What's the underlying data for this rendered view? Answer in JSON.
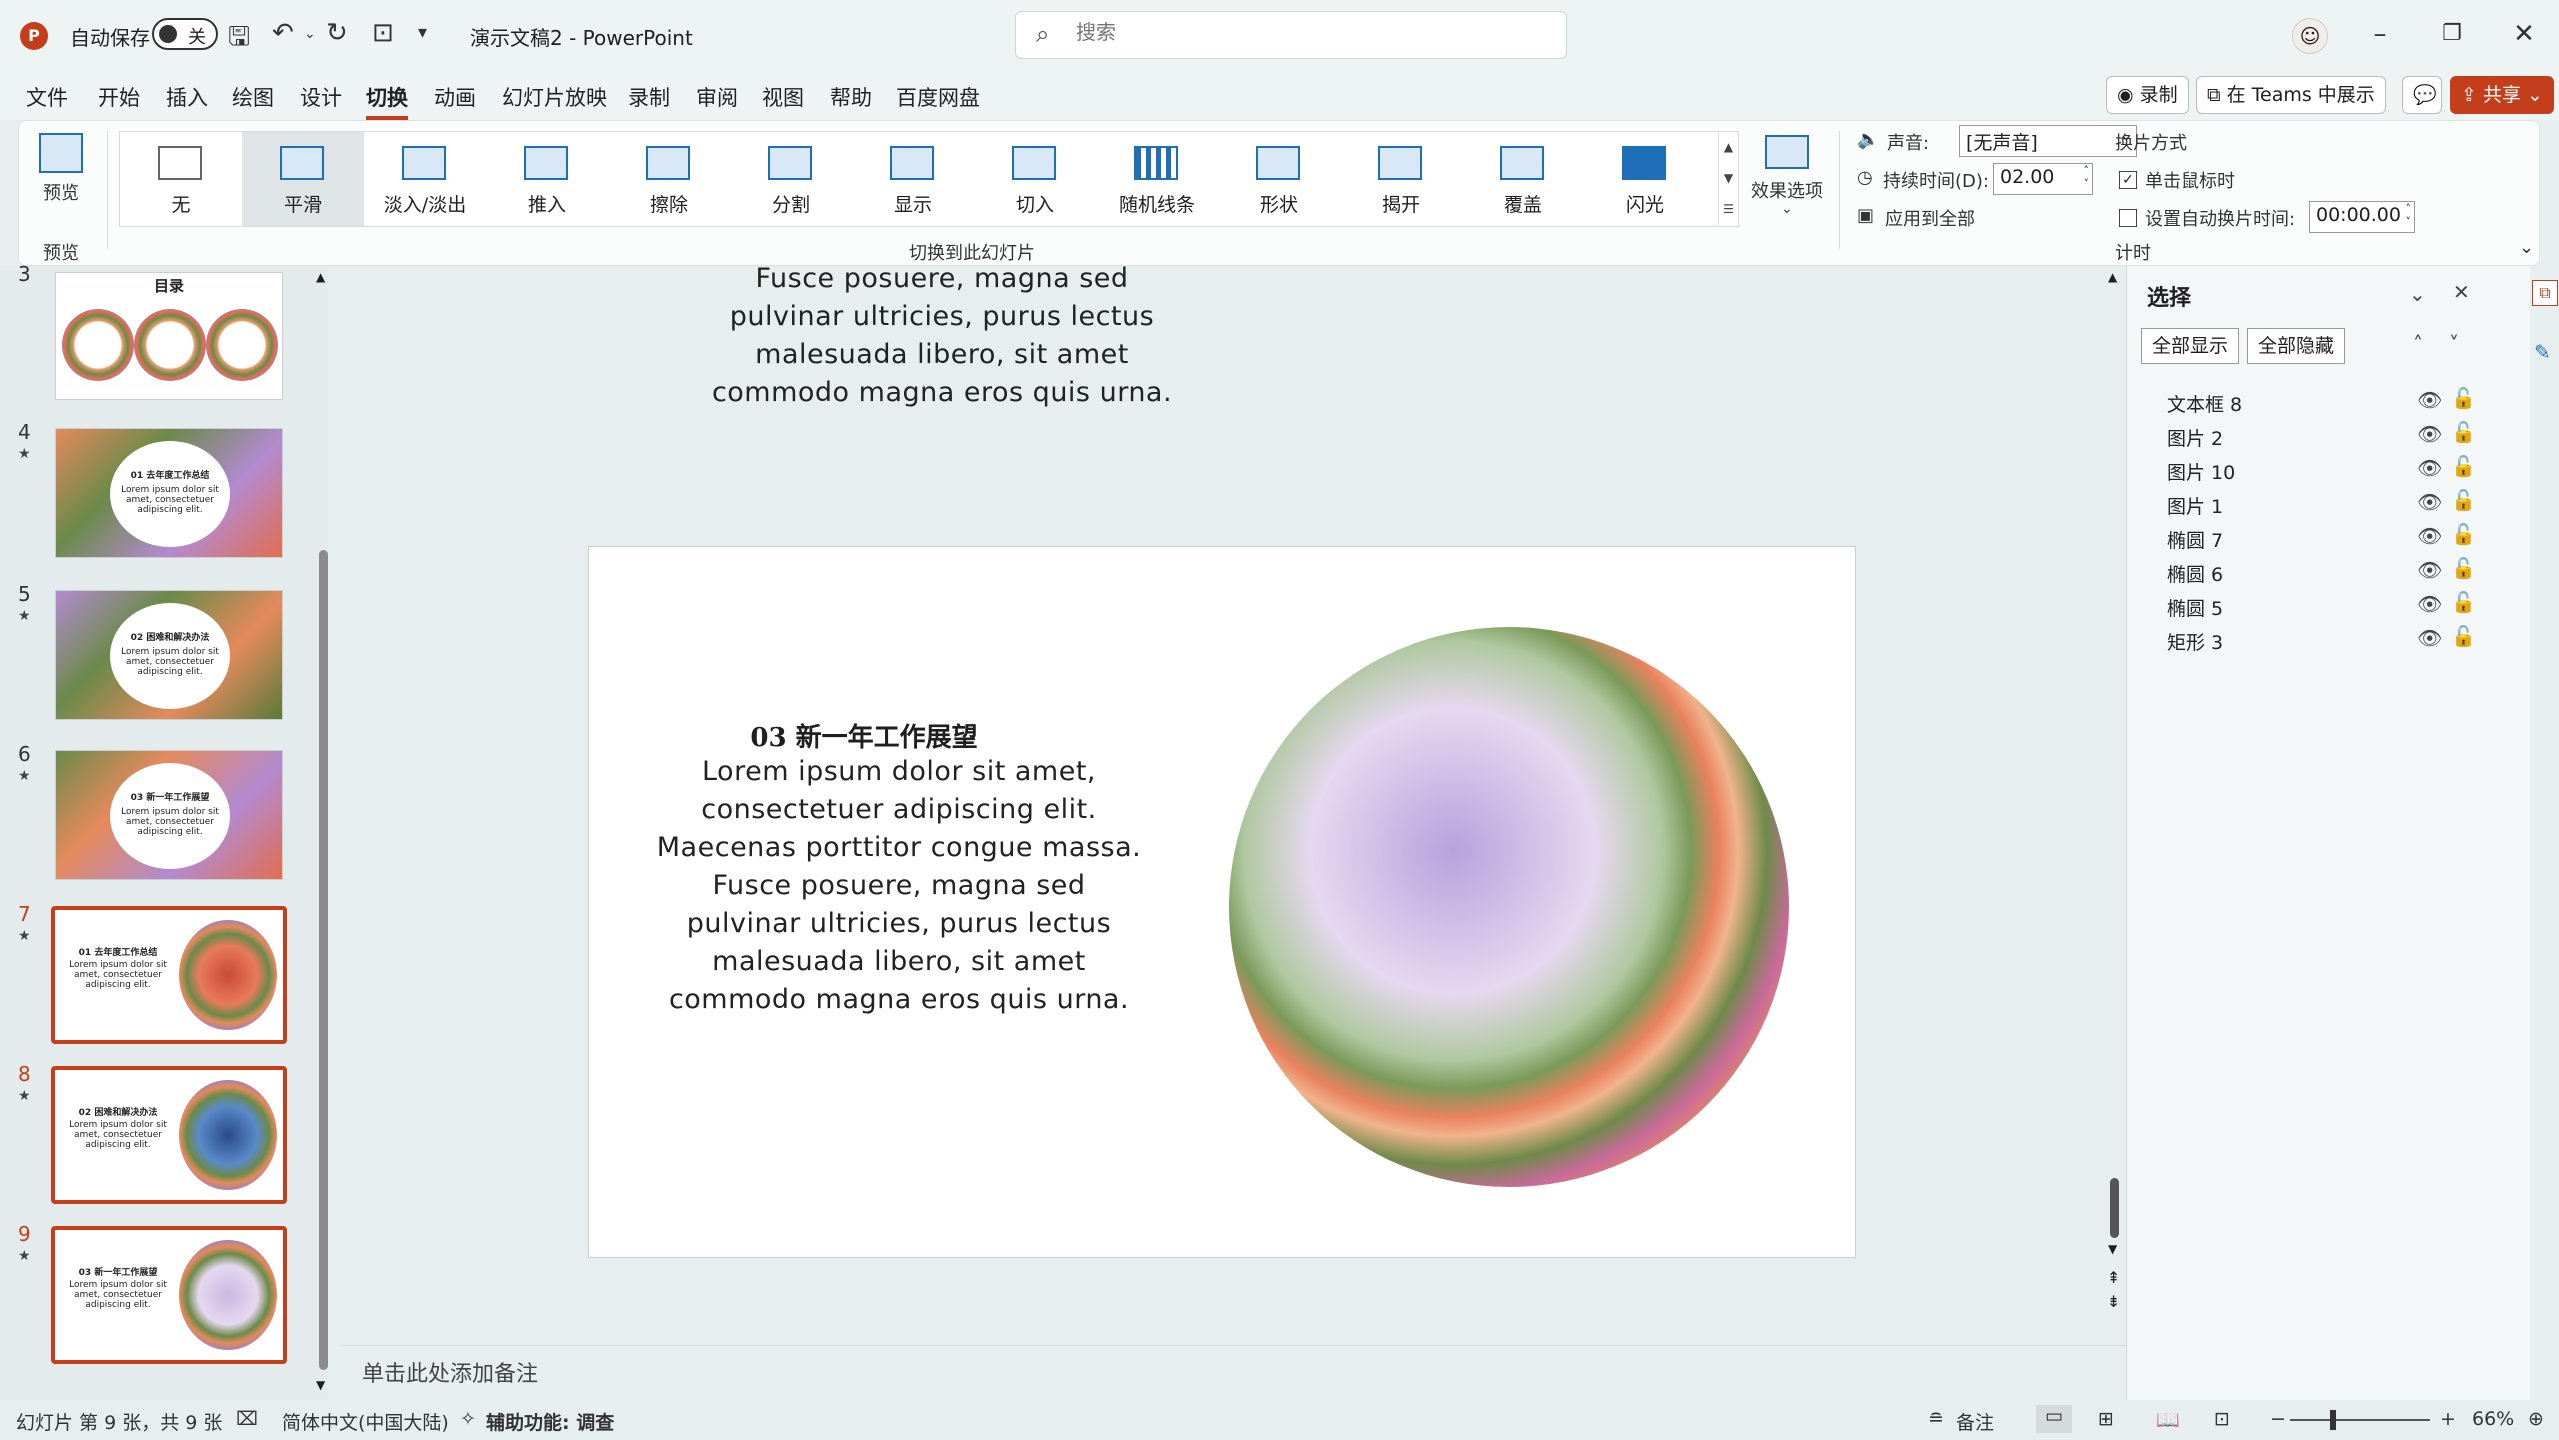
{
  "app": {
    "logo_letter": "P",
    "autosave_label": "自动保存",
    "autosave_state": "关",
    "doc_title": "演示文稿2  -  PowerPoint",
    "search_placeholder": "搜索"
  },
  "menu": {
    "tabs": [
      "文件",
      "开始",
      "插入",
      "绘图",
      "设计",
      "切换",
      "动画",
      "幻灯片放映",
      "录制",
      "审阅",
      "视图",
      "帮助",
      "百度网盘"
    ],
    "active_tab": "切换",
    "record_label": "录制",
    "teams_label": "在 Teams 中展示",
    "share_label": "共享"
  },
  "ribbon": {
    "preview_label": "预览",
    "preview_group": "预览",
    "transitions": [
      "无",
      "平滑",
      "淡入/淡出",
      "推入",
      "擦除",
      "分割",
      "显示",
      "切入",
      "随机线条",
      "形状",
      "揭开",
      "覆盖",
      "闪光"
    ],
    "selected_transition": "平滑",
    "transition_group": "切换到此幻灯片",
    "effect_options": "效果选项",
    "sound_label": "声音:",
    "sound_value": "[无声音]",
    "duration_label": "持续时间(D):",
    "duration_value": "02.00",
    "apply_all": "应用到全部",
    "advance_label": "换片方式",
    "on_click": "单击鼠标时",
    "auto_after": "设置自动换片时间:",
    "auto_value": "00:00.00",
    "timing_group": "计时"
  },
  "thumbnails": [
    {
      "num": "3",
      "title": "目录"
    },
    {
      "num": "4",
      "title": "01 去年度工作总结"
    },
    {
      "num": "5",
      "title": "02 困难和解决办法"
    },
    {
      "num": "6",
      "title": "03 新一年工作展望"
    },
    {
      "num": "7",
      "title": "01 去年度工作总结"
    },
    {
      "num": "8",
      "title": "02 困难和解决办法"
    },
    {
      "num": "9",
      "title": "03 新一年工作展望"
    }
  ],
  "slide": {
    "title": "03  新一年工作展望",
    "body_lines": [
      "Lorem ipsum dolor sit amet,",
      "consectetuer adipiscing elit.",
      "Maecenas porttitor congue massa.",
      "Fusce posuere, magna sed",
      "pulvinar ultricies, purus lectus",
      "malesuada libero, sit amet",
      "commodo magna eros quis urna."
    ],
    "prev_lines": [
      "Fusce posuere, magna sed",
      "pulvinar ultricies, purus lectus",
      "malesuada libero, sit amet",
      "commodo magna eros quis urna."
    ],
    "notes_placeholder": "单击此处添加备注"
  },
  "selection_pane": {
    "title": "选择",
    "show_all": "全部显示",
    "hide_all": "全部隐藏",
    "items": [
      "文本框 8",
      "图片 2",
      "图片 10",
      "图片 1",
      "椭圆 7",
      "椭圆 6",
      "椭圆 5",
      "矩形 3"
    ]
  },
  "status": {
    "slide_info": "幻灯片 第 9 张，共 9 张",
    "language": "简体中文(中国大陆)",
    "accessibility": "辅助功能: 调查",
    "notes": "备注",
    "zoom": "66%"
  },
  "thumb_body": "Lorem ipsum dolor sit amet, consectetuer adipiscing elit."
}
